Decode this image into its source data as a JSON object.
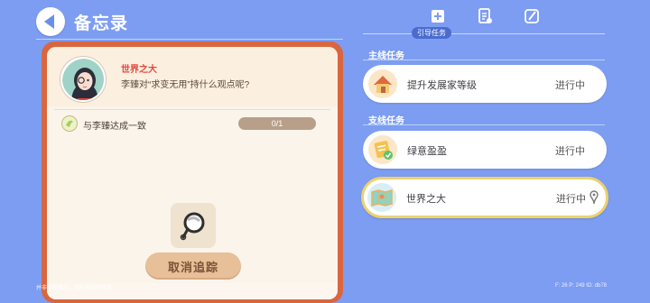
{
  "header": {
    "title": "备忘录",
    "back_icon": "back-arrow-icon"
  },
  "tabs": {
    "icons": [
      "guide-task-icon",
      "document-icon",
      "quill-icon"
    ],
    "active_label": "引导任务"
  },
  "detail": {
    "task_name": "世界之大",
    "question": "李臻对“求变无用”持什么观点呢?",
    "goal_label": "与李臻达成一致",
    "progress_text": "0/1",
    "progress_fraction": 0,
    "item_icon": "magnifier-item-icon",
    "cancel_label": "取消追踪"
  },
  "sections": {
    "main": {
      "title": "主线任务",
      "tasks": [
        {
          "label": "提升发展家等级",
          "status": "进行中",
          "icon": "house-icon"
        }
      ]
    },
    "side": {
      "title": "支线任务",
      "tasks": [
        {
          "label": "绿意盈盈",
          "status": "进行中",
          "icon": "green-task-icon"
        },
        {
          "label": "世界之大",
          "status": "进行中",
          "icon": "map-icon",
          "tracked": true
        }
      ]
    }
  },
  "footer": {
    "left": "并非原画填入，可能非最终效果",
    "right": "F: 26   P: 249   ID: db78"
  },
  "colors": {
    "background": "#7d9df2",
    "card_border": "#d9663e",
    "card_bg": "#fbf4ea",
    "accent_red": "#e04a3e",
    "selected_border": "#ecd16f",
    "button_bg": "#e7bf98"
  }
}
